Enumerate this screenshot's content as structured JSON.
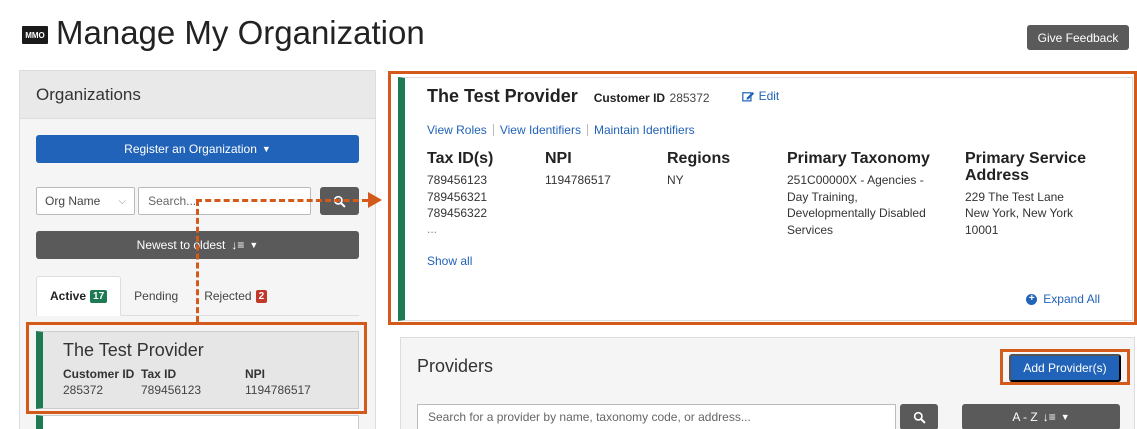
{
  "header": {
    "logo_text": "MMO",
    "title": "Manage My Organization",
    "feedback_label": "Give Feedback"
  },
  "left": {
    "title": "Organizations",
    "register_label": "Register an Organization",
    "org_select_value": "Org Name",
    "search_placeholder": "Search...",
    "sort_label": "Newest to oldest",
    "tabs": [
      {
        "label": "Active",
        "count": "17"
      },
      {
        "label": "Pending",
        "count": ""
      },
      {
        "label": "Rejected",
        "count": "2"
      }
    ],
    "card": {
      "name": "The Test Provider",
      "customer_id_label": "Customer ID",
      "customer_id": "285372",
      "tax_id_label": "Tax ID",
      "tax_id": "789456123",
      "npi_label": "NPI",
      "npi": "1194786517"
    }
  },
  "detail": {
    "name": "The Test Provider",
    "customer_id_label": "Customer ID",
    "customer_id": "285372",
    "edit_label": "Edit",
    "links": [
      "View Roles",
      "View Identifiers",
      "Maintain Identifiers"
    ],
    "columns": {
      "tax_ids": {
        "header": "Tax ID(s)",
        "values": [
          "789456123",
          "789456321",
          "789456322"
        ],
        "more": "..."
      },
      "npi": {
        "header": "NPI",
        "value": "1194786517"
      },
      "regions": {
        "header": "Regions",
        "value": "NY"
      },
      "taxonomy": {
        "header": "Primary Taxonomy",
        "lines": [
          "251C00000X - Agencies -",
          "Day Training,",
          "Developmentally Disabled",
          "Services"
        ]
      },
      "address": {
        "header": "Primary Service Address",
        "lines": [
          "229 The Test Lane",
          "New York, New York",
          "10001"
        ]
      }
    },
    "show_all_label": "Show all",
    "expand_all_label": "Expand All"
  },
  "providers": {
    "title": "Providers",
    "add_label": "Add Provider(s)",
    "search_placeholder": "Search for a provider by name, taxonomy code, or address...",
    "sort_label": "A - Z"
  },
  "colors": {
    "primary_blue": "#2163b8",
    "dark_button": "#5a5a5a",
    "accent_green": "#1e7a53",
    "highlight_orange": "#d35a1a",
    "badge_red": "#c0392b"
  }
}
